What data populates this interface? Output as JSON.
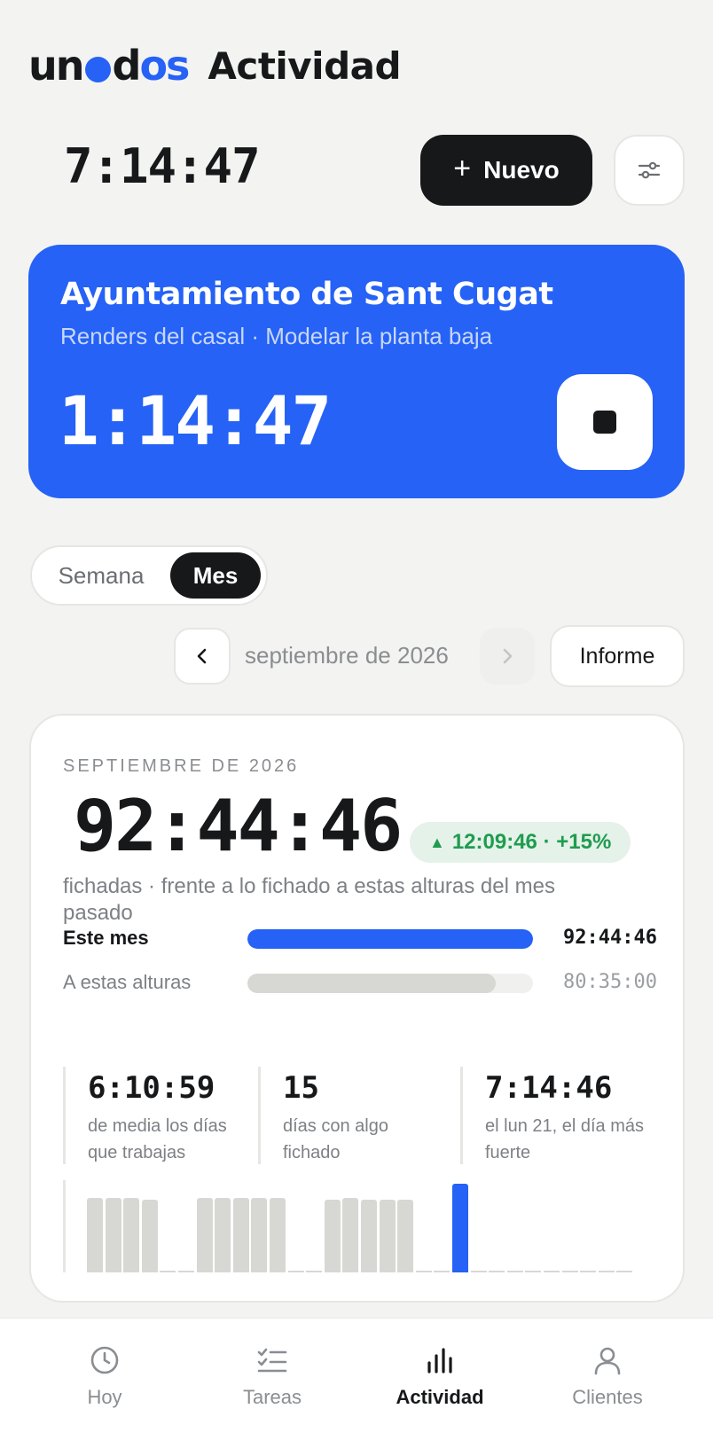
{
  "header": {
    "logo": {
      "part1": "un",
      "part2": "d",
      "part3": "os"
    },
    "title": "Actividad"
  },
  "clock": "7:14:47",
  "actions": {
    "new_label": "Nuevo",
    "new_icon": "plus-icon",
    "filter_icon": "sliders-icon"
  },
  "active_timer": {
    "client": "Ayuntamiento de Sant Cugat",
    "task": "Renders del casal · Modelar la planta baja",
    "elapsed": "1:14:47",
    "stop_icon": "stop-icon"
  },
  "range": {
    "week_label": "Semana",
    "month_label": "Mes",
    "selected": "Mes"
  },
  "period_nav": {
    "label": "septiembre de 2026",
    "report_label": "Informe"
  },
  "summary": {
    "eyebrow": "SEPTIEMBRE DE 2026",
    "total": "92:44:46",
    "delta": "12:09:46 · +15%",
    "caption": "fichadas · frente a lo fichado a estas alturas del mes pasado",
    "rows": [
      {
        "label": "Este mes",
        "value": "92:44:46",
        "fraction": 1.0
      },
      {
        "label": "A estas alturas",
        "value": "80:35:00",
        "fraction": 0.869
      }
    ],
    "stats": [
      {
        "value": "6:10:59",
        "desc": "de media los días que trabajas"
      },
      {
        "value": "15",
        "desc": "días con algo fichado"
      },
      {
        "value": "7:14:46",
        "desc": "el lun 21, el día más fuerte"
      }
    ],
    "daily_fraction": [
      0.84,
      0.84,
      0.84,
      0.82,
      0,
      0,
      0.84,
      0.84,
      0.84,
      0.84,
      0.84,
      0,
      0,
      0.82,
      0.84,
      0.82,
      0.82,
      0.82,
      0,
      0,
      1.0,
      0,
      0,
      0,
      0,
      0,
      0,
      0,
      0,
      0
    ],
    "today_index": 20
  },
  "tabs": [
    {
      "label": "Hoy",
      "icon": "clock-icon"
    },
    {
      "label": "Tareas",
      "icon": "checklist-icon"
    },
    {
      "label": "Actividad",
      "icon": "bar-chart-icon",
      "active": true
    },
    {
      "label": "Clientes",
      "icon": "person-icon"
    }
  ],
  "colors": {
    "accent": "#2562f5",
    "dark": "#17181a",
    "positive": "#1f9c4f",
    "muted_bar": "#d7d8d3"
  }
}
